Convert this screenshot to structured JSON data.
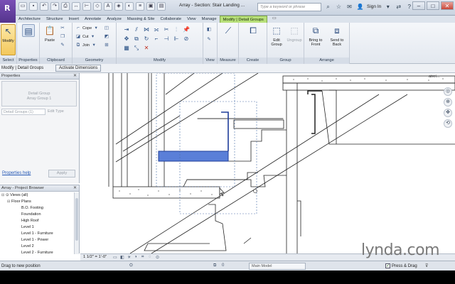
{
  "titlebar": {
    "app_letter": "R",
    "title": "Array - Section: Stair Landing ...",
    "search_placeholder": "Type a keyword or phrase",
    "sign_in": "Sign In",
    "qat_icons": [
      "open-icon",
      "save-icon",
      "undo-icon",
      "redo-icon",
      "print-icon",
      "measure-icon",
      "dimension-icon",
      "tag-icon",
      "text-icon",
      "3d-view-icon",
      "section-icon",
      "thin-lines-icon",
      "close-hidden-icon",
      "switch-windows-icon"
    ],
    "window_controls": [
      "–",
      "□",
      "✕"
    ]
  },
  "ribbon_tabs": [
    "Architecture",
    "Structure",
    "Insert",
    "Annotate",
    "Analyze",
    "Massing & Site",
    "Collaborate",
    "View",
    "Manage",
    "Modify | Detail Groups"
  ],
  "active_tab": "Modify | Detail Groups",
  "ribbon": {
    "select_panel": {
      "label": "Select",
      "modify_label": "Modify"
    },
    "properties_panel": {
      "label": "Properties",
      "button": "Properties"
    },
    "clipboard_panel": {
      "label": "Clipboard",
      "paste_label": "Paste"
    },
    "geometry_panel": {
      "label": "Geometry",
      "cope": "Cope",
      "cut": "Cut",
      "join": "Join"
    },
    "modify_panel": {
      "label": "Modify"
    },
    "view_panel": {
      "label": "View"
    },
    "measure_panel": {
      "label": "Measure"
    },
    "create_panel": {
      "label": "Create"
    },
    "group_panel": {
      "label": "Group",
      "edit_group": "Edit Group",
      "ungroup": "Ungroup"
    },
    "arrange_panel": {
      "label": "Arrange",
      "bring_front": "Bring to Front",
      "send_back": "Send to Back"
    }
  },
  "options_bar": {
    "context": "Modify | Detail Groups",
    "activate_dimensions": "Activate Dimensions"
  },
  "properties": {
    "header": "Properties",
    "type_line1": "Detail Group",
    "type_line2": "Array Group 1",
    "instance_selector": "Detail Groups (1)",
    "edit_type": "Edit Type",
    "help_link": "Properties help",
    "apply": "Apply"
  },
  "project_browser": {
    "header": "Array - Project Browser",
    "items": [
      {
        "label": "Views (all)",
        "level": 0,
        "toggle": "⊟"
      },
      {
        "label": "Floor Plans",
        "level": 1,
        "toggle": "⊟"
      },
      {
        "label": "B.O. Footing",
        "level": 2,
        "toggle": ""
      },
      {
        "label": "Foundation",
        "level": 2,
        "toggle": ""
      },
      {
        "label": "High Roof",
        "level": 2,
        "toggle": ""
      },
      {
        "label": "Level 1",
        "level": 2,
        "toggle": ""
      },
      {
        "label": "Level 1 - Furniture",
        "level": 2,
        "toggle": ""
      },
      {
        "label": "Level 1 - Power",
        "level": 2,
        "toggle": ""
      },
      {
        "label": "Level 2",
        "level": 2,
        "toggle": ""
      },
      {
        "label": "Level 2 - Furniture",
        "level": 2,
        "toggle": ""
      }
    ]
  },
  "canvas": {
    "view_label": "atrel...",
    "nav_icons": [
      "steering-wheel-icon",
      "zoom-icon",
      "pan-icon",
      "orbit-icon"
    ]
  },
  "view_control_bar": {
    "scale": "1 1/2\" = 1'-0\""
  },
  "status_bar": {
    "message": "Drag to new position",
    "model": "Main Model",
    "press_drag": "Press & Drag",
    "filter_count": "0"
  },
  "watermark": "lynda.com"
}
